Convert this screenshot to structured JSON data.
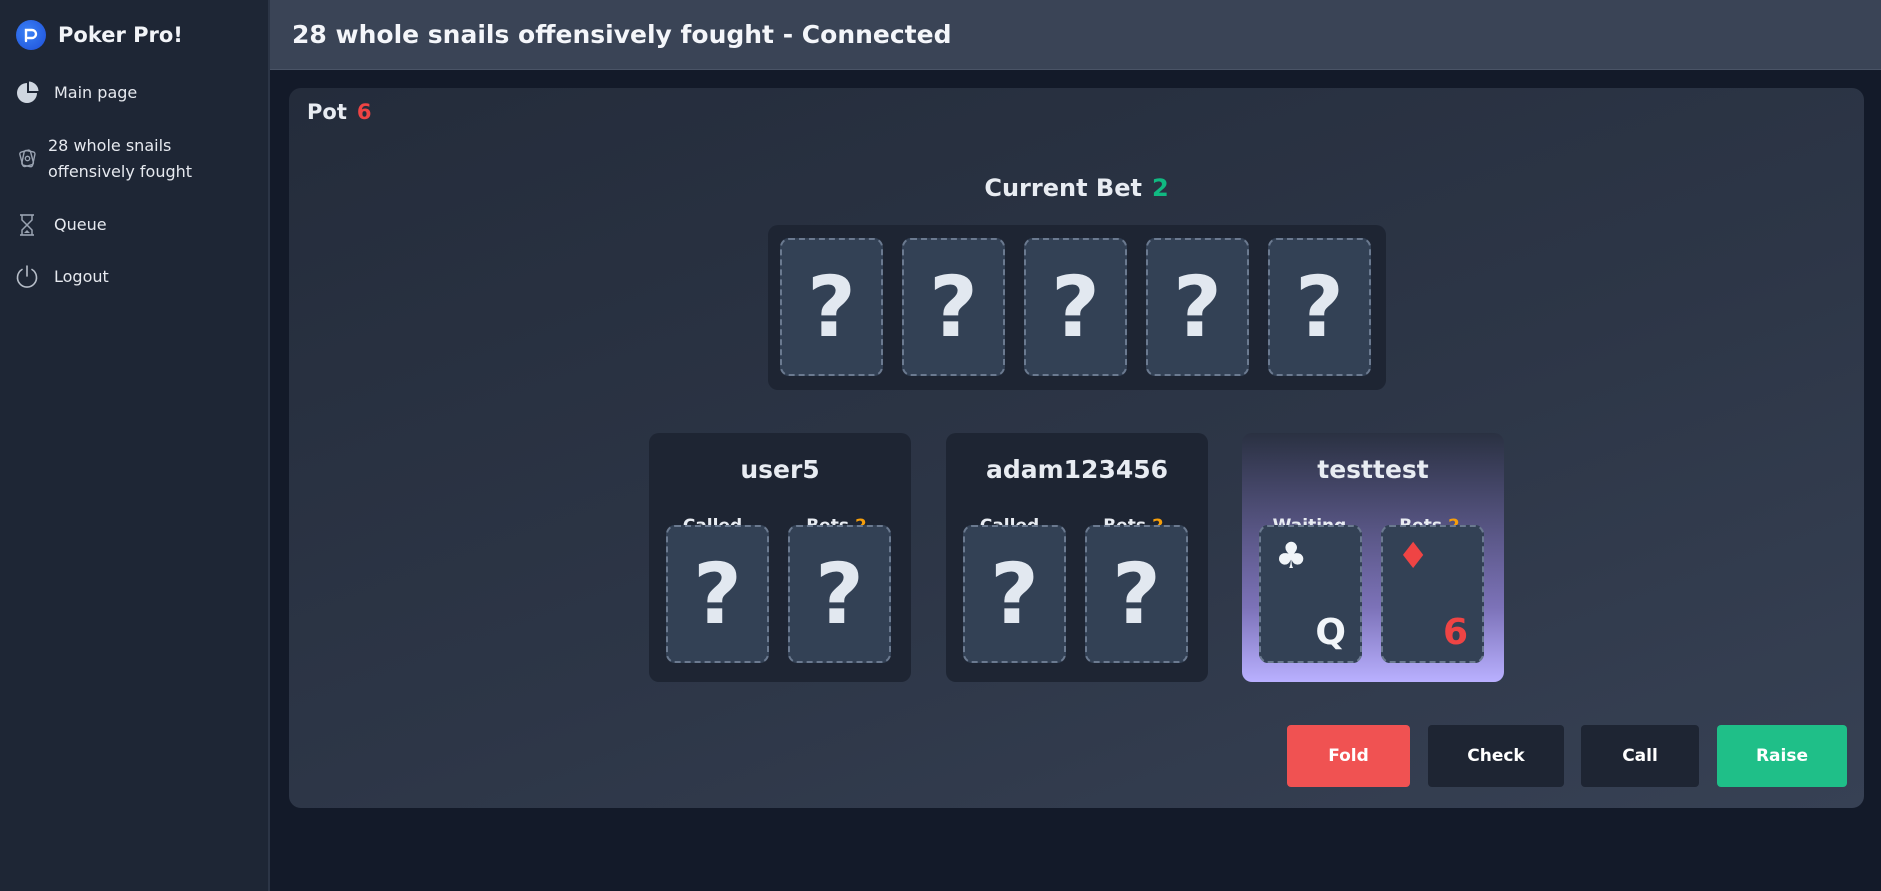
{
  "app": {
    "title": "Poker Pro!"
  },
  "sidebar": {
    "items": [
      {
        "label": "Main page",
        "icon": "pie-chart-icon"
      },
      {
        "label": "28 whole snails offensively fought",
        "icon": "cards-icon"
      },
      {
        "label": "Queue",
        "icon": "hourglass-icon"
      },
      {
        "label": "Logout",
        "icon": "power-icon"
      }
    ]
  },
  "header": {
    "title": "28 whole snails offensively fought - Connected"
  },
  "table": {
    "pot_label": "Pot",
    "pot_value": "6",
    "current_bet_label": "Current Bet",
    "current_bet_value": "2",
    "community_cards": [
      "?",
      "?",
      "?",
      "?",
      "?"
    ]
  },
  "players": [
    {
      "name": "user5",
      "status": "Called",
      "bets_label": "Bets",
      "bets_value": "2",
      "cards": [
        {
          "hidden": true,
          "text": "?"
        },
        {
          "hidden": true,
          "text": "?"
        }
      ]
    },
    {
      "name": "adam123456",
      "status": "Called",
      "bets_label": "Bets",
      "bets_value": "2",
      "cards": [
        {
          "hidden": true,
          "text": "?"
        },
        {
          "hidden": true,
          "text": "?"
        }
      ]
    },
    {
      "name": "testtest",
      "status": "Waiting",
      "bets_label": "Bets",
      "bets_value": "2",
      "cards": [
        {
          "hidden": false,
          "suit": "♣",
          "rank": "Q",
          "color": "#f1f5f9"
        },
        {
          "hidden": false,
          "suit": "♦",
          "rank": "6",
          "color": "#ef4444"
        }
      ]
    }
  ],
  "actions": {
    "fold": "Fold",
    "check": "Check",
    "call": "Call",
    "raise": "Raise"
  },
  "colors": {
    "pot": "#ef4444",
    "current_bet": "#10b981",
    "bets": "#f59e0b",
    "fold": "#f05252",
    "raise": "#10b981",
    "neutral_button": "#1e2533"
  }
}
